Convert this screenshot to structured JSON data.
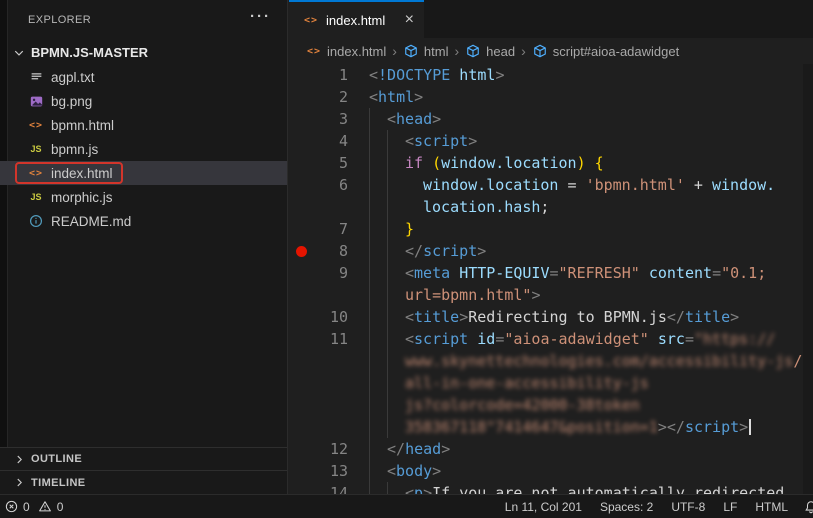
{
  "explorer": {
    "title": "EXPLORER",
    "more_actions": "···",
    "folder": {
      "name": "BPMN.JS-MASTER",
      "expanded": true
    },
    "files": [
      {
        "name": "agpl.txt",
        "type": "text"
      },
      {
        "name": "bg.png",
        "type": "image"
      },
      {
        "name": "bpmn.html",
        "type": "html"
      },
      {
        "name": "bpmn.js",
        "type": "js"
      },
      {
        "name": "index.html",
        "type": "html",
        "selected": true,
        "highlight_box": true
      },
      {
        "name": "morphic.js",
        "type": "js"
      },
      {
        "name": "README.md",
        "type": "info"
      }
    ],
    "sections": [
      {
        "label": "OUTLINE"
      },
      {
        "label": "TIMELINE"
      }
    ]
  },
  "editor": {
    "tab": {
      "label": "index.html",
      "close": "×"
    },
    "breadcrumb": {
      "separator": "›",
      "items": [
        {
          "label": "index.html",
          "icon": "html-file"
        },
        {
          "label": "html",
          "icon": "symbol-cube"
        },
        {
          "label": "head",
          "icon": "symbol-cube"
        },
        {
          "label": "script#aioa-adawidget",
          "icon": "symbol-cube"
        }
      ]
    },
    "rows": [
      {
        "ln": "1",
        "ind": 0,
        "guides": 0,
        "segs": [
          {
            "t": "<",
            "c": "p"
          },
          {
            "t": "!DOCTYPE",
            "c": "tag"
          },
          {
            "t": " html",
            "c": "attr"
          },
          {
            "t": ">",
            "c": "p"
          }
        ]
      },
      {
        "ln": "2",
        "ind": 0,
        "guides": 0,
        "segs": [
          {
            "t": "<",
            "c": "p"
          },
          {
            "t": "html",
            "c": "tag"
          },
          {
            "t": ">",
            "c": "p"
          }
        ]
      },
      {
        "ln": "3",
        "ind": 2,
        "guides": 1,
        "segs": [
          {
            "t": "<",
            "c": "p"
          },
          {
            "t": "head",
            "c": "tag"
          },
          {
            "t": ">",
            "c": "p"
          }
        ]
      },
      {
        "ln": "4",
        "ind": 4,
        "guides": 2,
        "segs": [
          {
            "t": "<",
            "c": "p"
          },
          {
            "t": "script",
            "c": "tag"
          },
          {
            "t": ">",
            "c": "p"
          }
        ]
      },
      {
        "ln": "5",
        "ind": 4,
        "guides": 2,
        "segs": [
          {
            "t": "if",
            "c": "kw"
          },
          {
            "t": " ",
            "c": "pl"
          },
          {
            "t": "(",
            "c": "br"
          },
          {
            "t": "window.location",
            "c": "attr"
          },
          {
            "t": ")",
            "c": "br"
          },
          {
            "t": " ",
            "c": "pl"
          },
          {
            "t": "{",
            "c": "br"
          }
        ]
      },
      {
        "ln": "6",
        "ind": 6,
        "guides": 2,
        "segs": [
          {
            "t": "window.location",
            "c": "attr"
          },
          {
            "t": " = ",
            "c": "pl"
          },
          {
            "t": "'bpmn.html'",
            "c": "str"
          },
          {
            "t": " + ",
            "c": "pl"
          },
          {
            "t": "window.",
            "c": "attr"
          }
        ]
      },
      {
        "ln": "",
        "ind": 6,
        "guides": 2,
        "segs": [
          {
            "t": "location.hash",
            "c": "attr"
          },
          {
            "t": ";",
            "c": "pl"
          }
        ]
      },
      {
        "ln": "7",
        "ind": 4,
        "guides": 2,
        "segs": [
          {
            "t": "}",
            "c": "br"
          }
        ]
      },
      {
        "ln": "8",
        "ind": 4,
        "guides": 2,
        "bp": true,
        "segs": [
          {
            "t": "</",
            "c": "p"
          },
          {
            "t": "script",
            "c": "tag"
          },
          {
            "t": ">",
            "c": "p"
          }
        ]
      },
      {
        "ln": "9",
        "ind": 4,
        "guides": 2,
        "segs": [
          {
            "t": "<",
            "c": "p"
          },
          {
            "t": "meta",
            "c": "tag"
          },
          {
            "t": " ",
            "c": "pl"
          },
          {
            "t": "HTTP-EQUIV",
            "c": "attr"
          },
          {
            "t": "=",
            "c": "p"
          },
          {
            "t": "\"REFRESH\"",
            "c": "str"
          },
          {
            "t": " ",
            "c": "pl"
          },
          {
            "t": "content",
            "c": "attr"
          },
          {
            "t": "=",
            "c": "p"
          },
          {
            "t": "\"0.1;",
            "c": "str"
          }
        ]
      },
      {
        "ln": "",
        "ind": 4,
        "guides": 2,
        "segs": [
          {
            "t": "url=bpmn.html\"",
            "c": "str"
          },
          {
            "t": ">",
            "c": "p"
          }
        ]
      },
      {
        "ln": "10",
        "ind": 4,
        "guides": 2,
        "segs": [
          {
            "t": "<",
            "c": "p"
          },
          {
            "t": "title",
            "c": "tag"
          },
          {
            "t": ">",
            "c": "p"
          },
          {
            "t": "Redirecting to BPMN.js",
            "c": "pl"
          },
          {
            "t": "</",
            "c": "p"
          },
          {
            "t": "title",
            "c": "tag"
          },
          {
            "t": ">",
            "c": "p"
          }
        ]
      },
      {
        "ln": "11",
        "ind": 4,
        "guides": 2,
        "segs": [
          {
            "t": "<",
            "c": "p"
          },
          {
            "t": "script",
            "c": "tag"
          },
          {
            "t": " ",
            "c": "pl"
          },
          {
            "t": "id",
            "c": "attr"
          },
          {
            "t": "=",
            "c": "p"
          },
          {
            "t": "\"aioa-adawidget\"",
            "c": "str"
          },
          {
            "t": " ",
            "c": "pl"
          },
          {
            "t": "src",
            "c": "attr"
          },
          {
            "t": "=",
            "c": "p"
          },
          {
            "t": "\"https://",
            "c": "str",
            "blur": true
          }
        ]
      },
      {
        "ln": "",
        "ind": 4,
        "guides": 2,
        "segs": [
          {
            "t": "www.skynettechnologies.com/accessibility-js",
            "c": "str",
            "blur": true
          },
          {
            "t": "/",
            "c": "str"
          }
        ]
      },
      {
        "ln": "",
        "ind": 4,
        "guides": 2,
        "segs": [
          {
            "t": "all-in-one-accessibility-js",
            "c": "str",
            "blur": true
          }
        ]
      },
      {
        "ln": "",
        "ind": 4,
        "guides": 2,
        "segs": [
          {
            "t": "js?colorcode=42000-38token",
            "c": "str",
            "blur": true
          }
        ]
      },
      {
        "ln": "",
        "ind": 4,
        "guides": 2,
        "cursor": true,
        "segs": [
          {
            "t": "358367118\"7414647&position=1",
            "c": "str",
            "blur": true
          },
          {
            "t": ">",
            "c": "p"
          },
          {
            "t": "</",
            "c": "p"
          },
          {
            "t": "script",
            "c": "tag"
          },
          {
            "t": ">",
            "c": "p"
          }
        ]
      },
      {
        "ln": "12",
        "ind": 2,
        "guides": 1,
        "segs": [
          {
            "t": "</",
            "c": "p"
          },
          {
            "t": "head",
            "c": "tag"
          },
          {
            "t": ">",
            "c": "p"
          }
        ]
      },
      {
        "ln": "13",
        "ind": 2,
        "guides": 1,
        "segs": [
          {
            "t": "<",
            "c": "p"
          },
          {
            "t": "body",
            "c": "tag"
          },
          {
            "t": ">",
            "c": "p"
          }
        ]
      },
      {
        "ln": "14",
        "ind": 4,
        "guides": 2,
        "segs": [
          {
            "t": "<",
            "c": "p"
          },
          {
            "t": "p",
            "c": "tag"
          },
          {
            "t": ">",
            "c": "p"
          },
          {
            "t": "If you are not automatically redirected",
            "c": "pl"
          }
        ]
      }
    ]
  },
  "status_bar": {
    "errors": "0",
    "warnings": "0",
    "items": [
      {
        "name": "cursor-position",
        "label": "Ln 11, Col 201"
      },
      {
        "name": "indentation",
        "label": "Spaces: 2"
      },
      {
        "name": "encoding",
        "label": "UTF-8"
      },
      {
        "name": "eol",
        "label": "LF"
      },
      {
        "name": "language-mode",
        "label": "HTML"
      }
    ]
  },
  "colors": {
    "accent_blue": "#0078d4",
    "breakpoint_red": "#e51400",
    "annotation_red": "#d2352b",
    "html_icon_orange": "#e0823d",
    "js_icon_yellow": "#cbcb41",
    "readme_icon_blue": "#519aba",
    "image_icon_purple": "#9e6bc6",
    "symbol_icon_blue": "#4fb0ff",
    "string_orange": "#ce9178",
    "tag_blue": "#569cd6"
  }
}
